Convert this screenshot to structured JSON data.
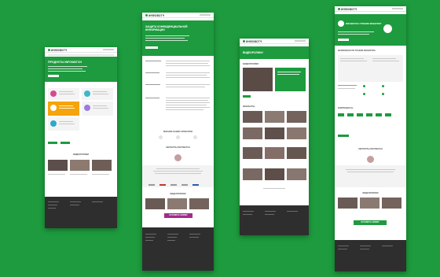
{
  "pages": [
    {
      "logo": "ИНФОВОТЧ",
      "hero_title": "ПРОДУКТЫ INFOWATCH",
      "video_heading": "ВИДЕОРОЛИКИ"
    },
    {
      "logo": "ИНФОВОТЧ",
      "hero_title_1": "ЗАЩИТА КОНФИДЕНЦИАЛЬНОЙ",
      "hero_title_2": "ИНФОРМАЦИИ",
      "section_1": "МНЕНИЯ НАШИХ КЛИЕНТОВ",
      "section_2": "ЭКСПЕРТЫ INFOWATCH",
      "section_3": "ВИДЕОРОЛИКИ",
      "cta": "ОСТАВИТЬ ЗАЯВКУ"
    },
    {
      "logo": "ИНФОВОТЧ",
      "hero_title": "ВИДЕОРОЛИКИ",
      "section_1": "ВИДЕОРОЛИКИ",
      "section_2": "ВЕБИНАРЫ"
    },
    {
      "logo": "ИНФОВОТЧ",
      "hero_title": "INFOWATCH ТРАФИК МОНИТОР",
      "section_1": "ВОЗМОЖНОСТИ ТРАФИК МОНИТОРА",
      "section_2": "КОМПОНЕНТЫ",
      "section_3": "ЭКСПЕРТЫ INFOWATCH",
      "section_4": "ВИДЕОРОЛИКИ",
      "cta": "ОСТАВИТЬ ЗАЯВКУ"
    }
  ],
  "colors": {
    "background": "#1d9b3e",
    "brand_green": "#1d9b3e",
    "footer": "#2e2e2e",
    "accent_orange": "#f5a40a",
    "accent_purple": "#a12c8c"
  }
}
